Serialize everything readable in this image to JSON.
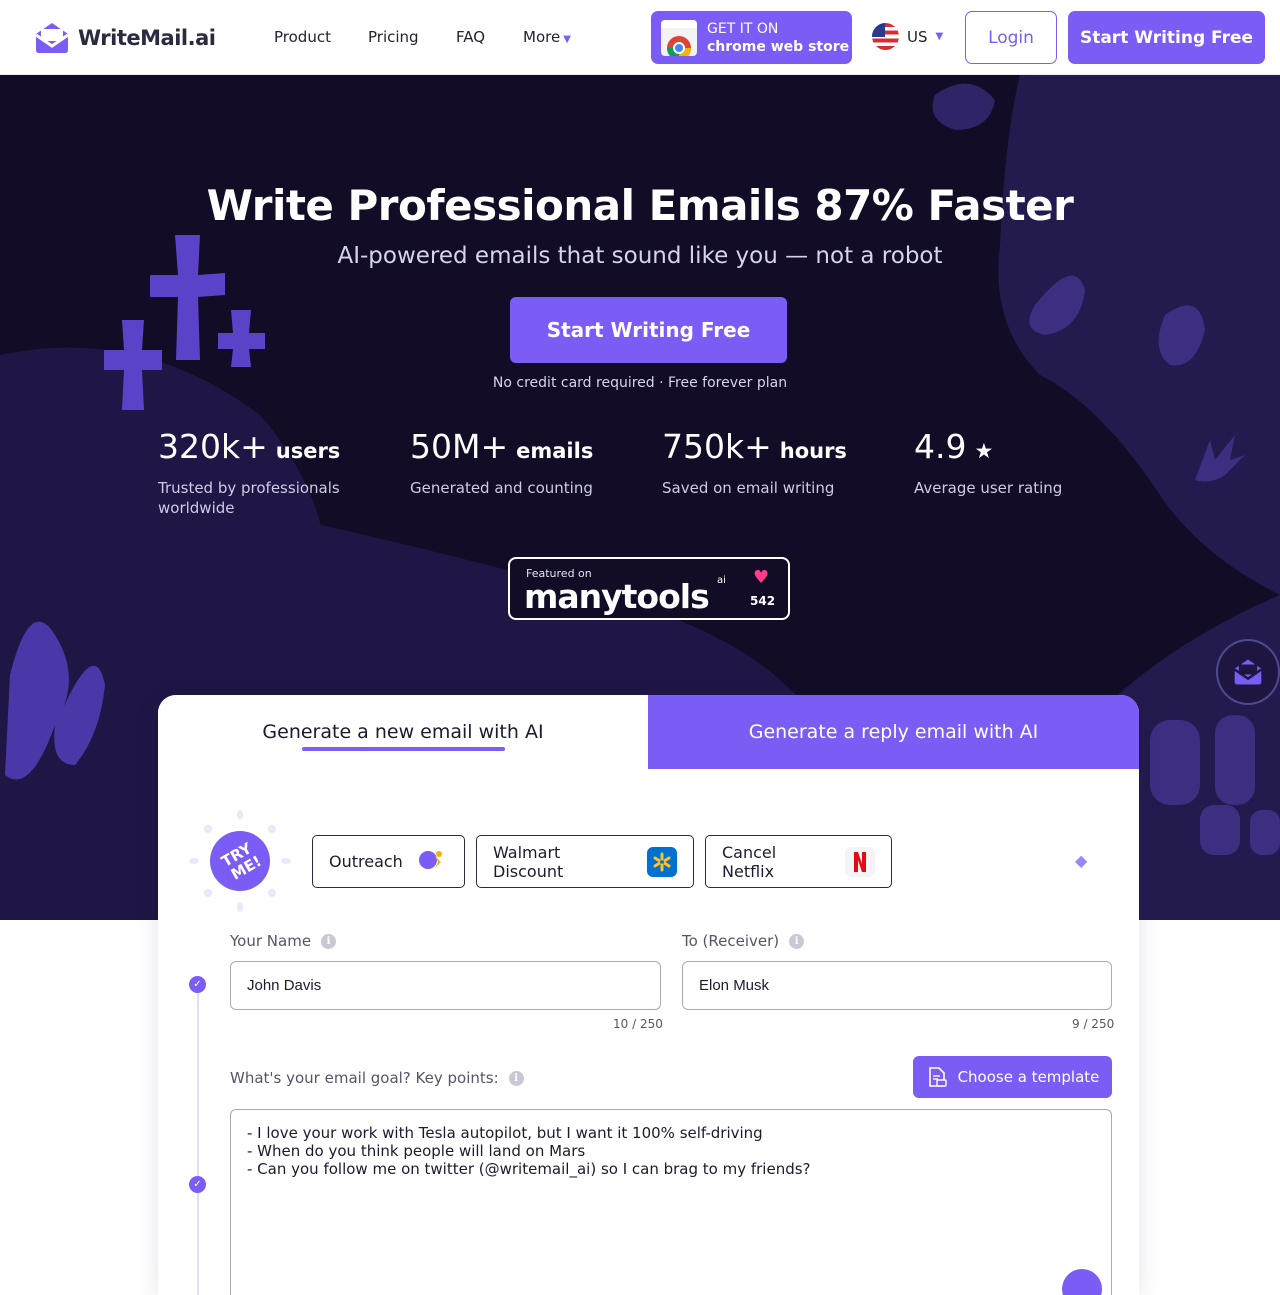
{
  "nav": {
    "brand": "WriteMail.ai",
    "links": [
      {
        "label": "Product"
      },
      {
        "label": "Pricing"
      },
      {
        "label": "FAQ"
      },
      {
        "label": "More"
      }
    ],
    "chrome": {
      "line1": "GET IT ON",
      "line2": "chrome web store"
    },
    "locale": "US",
    "login": "Login",
    "cta": "Start Writing Free"
  },
  "hero": {
    "title": "Write Professional Emails 87% Faster",
    "subtitle": "AI-powered emails that sound like you — not a robot",
    "cta": "Start Writing Free",
    "note": "No credit card required · Free forever plan",
    "stats": [
      {
        "value": "320k+",
        "unit": "users",
        "desc": "Trusted by professionals worldwide"
      },
      {
        "value": "50M+",
        "unit": "emails",
        "desc": "Generated and counting"
      },
      {
        "value": "750k+",
        "unit": "hours",
        "desc": "Saved on email writing"
      },
      {
        "value": "4.9",
        "unit": "★",
        "desc": "Average user rating"
      }
    ],
    "badge": {
      "featured": "Featured on",
      "name": "manytools",
      "suffix": "ai",
      "count": "542"
    }
  },
  "card": {
    "tab_new": "Generate a new email with AI",
    "tab_reply": "Generate a reply email with AI",
    "try_me": "TRY ME!",
    "examples": [
      {
        "label": "Outreach",
        "icon": "person-idea-icon"
      },
      {
        "label": "Walmart Discount",
        "icon": "walmart-spark-icon"
      },
      {
        "label": "Cancel Netflix",
        "icon": "netflix-icon"
      }
    ],
    "name_label": "Your Name",
    "name_value": "John Davis",
    "name_counter": "10 / 250",
    "to_label": "To (Receiver)",
    "to_value": "Elon Musk",
    "to_counter": "9 / 250",
    "goal_label": "What's your email goal? Key points:",
    "template_button": "Choose a template",
    "goal_text": "- I love your work with Tesla autopilot, but I want it 100% self-driving\n- When do you think people will land on Mars\n- Can you follow me on twitter (@writemail_ai) so I can brag to my friends?"
  },
  "colors": {
    "accent": "#7b5cf5",
    "hero_bg": "#120c26",
    "blob": "#2a1f5c",
    "blob_light": "#3d2e82"
  }
}
